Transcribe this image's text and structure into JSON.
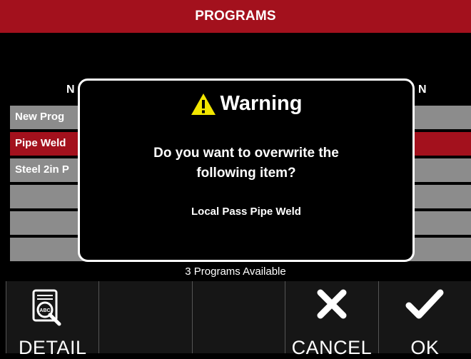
{
  "header": {
    "title": "PROGRAMS"
  },
  "columns": {
    "name_header": "N",
    "right_header": "N"
  },
  "rows": [
    {
      "label": "New Prog",
      "selected": false
    },
    {
      "label": "Pipe Weld",
      "selected": true
    },
    {
      "label": "Steel 2in P",
      "selected": false
    },
    {
      "label": "",
      "selected": false
    },
    {
      "label": "",
      "selected": false
    },
    {
      "label": "",
      "selected": false
    }
  ],
  "status": {
    "text": "3 Programs Available"
  },
  "dialog": {
    "icon": "warning-icon",
    "title": "Warning",
    "message_line1": "Do you want to overwrite the",
    "message_line2": "following item?",
    "item_name": "Local Pass Pipe Weld"
  },
  "toolbar": {
    "detail_label": "DETAIL",
    "detail_icon": "document-search-icon",
    "cancel_label": "CANCEL",
    "cancel_icon": "x-icon",
    "ok_label": "OK",
    "ok_icon": "checkmark-icon"
  },
  "colors": {
    "brand_red": "#a3111d",
    "row_gray": "#8c8c8c",
    "warning_yellow": "#f2e600"
  }
}
